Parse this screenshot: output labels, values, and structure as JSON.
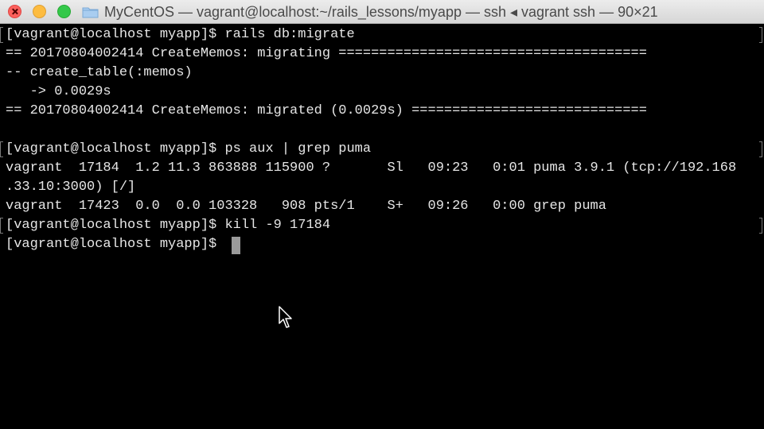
{
  "window": {
    "title": "MyCentOS — vagrant@localhost:~/rails_lessons/myapp — ssh ◂ vagrant ssh — 90×21",
    "icons": {
      "close": "close-button",
      "minimize": "minimize-button",
      "zoom": "zoom-button",
      "folder": "folder-icon"
    }
  },
  "terminal": {
    "lines": [
      "[vagrant@localhost myapp]$ rails db:migrate",
      "== 20170804002414 CreateMemos: migrating ======================================",
      "-- create_table(:memos)",
      "   -> 0.0029s",
      "== 20170804002414 CreateMemos: migrated (0.0029s) =============================",
      "",
      "[vagrant@localhost myapp]$ ps aux | grep puma",
      "vagrant  17184  1.2 11.3 863888 115900 ?       Sl   09:23   0:01 puma 3.9.1 (tcp://192.168",
      ".33.10:3000) [/]",
      "vagrant  17423  0.0  0.0 103328   908 pts/1    S+   09:26   0:00 grep puma",
      "[vagrant@localhost myapp]$ kill -9 17184",
      "[vagrant@localhost myapp]$ "
    ]
  },
  "colors": {
    "background": "#000000",
    "text": "#e6e6e6",
    "cursor": "#9a9a9a"
  }
}
